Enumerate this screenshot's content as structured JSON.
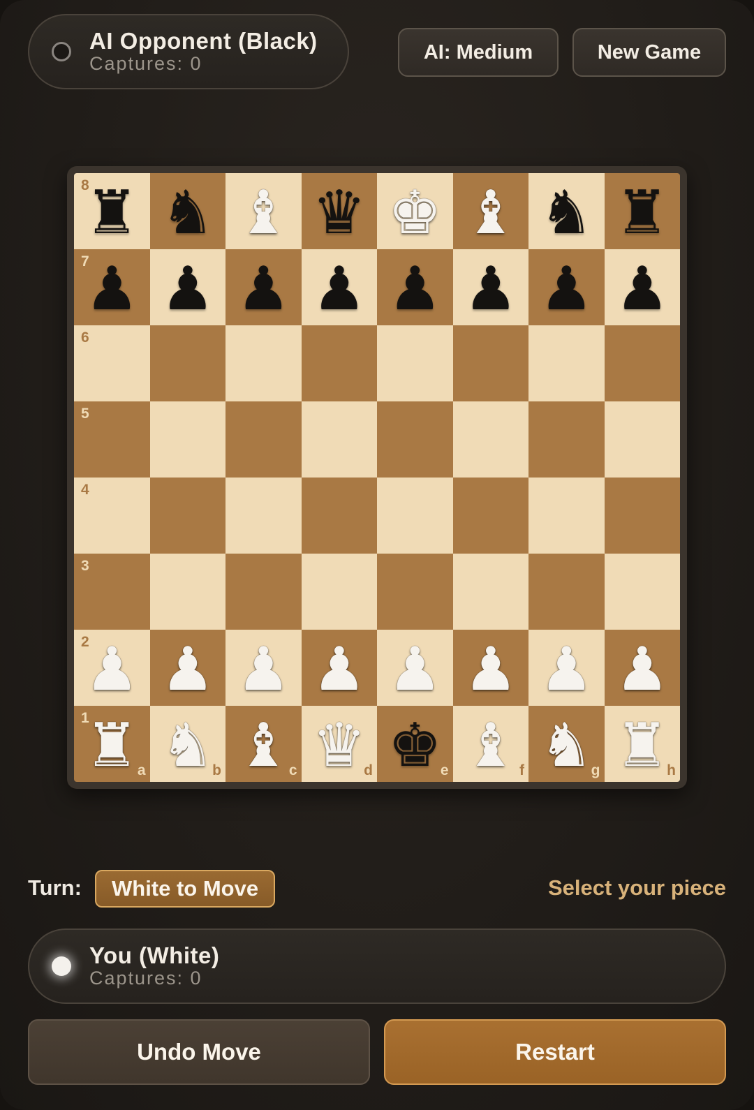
{
  "opponent": {
    "name": "AI Opponent (Black)",
    "captures": "Captures: 0"
  },
  "toolbar": {
    "ai_level_label": "AI: Medium",
    "new_game_label": "New Game"
  },
  "board": {
    "rank_labels": [
      "8",
      "7",
      "6",
      "5",
      "4",
      "3",
      "2",
      "1"
    ],
    "file_labels": [
      "a",
      "b",
      "c",
      "d",
      "e",
      "f",
      "g",
      "h"
    ],
    "pieces": [
      [
        "black-rook",
        "black-knight",
        "white-bishop",
        "black-queen",
        "white-king",
        "white-bishop",
        "black-knight",
        "black-rook"
      ],
      [
        "black-pawn",
        "black-pawn",
        "black-pawn",
        "black-pawn",
        "black-pawn",
        "black-pawn",
        "black-pawn",
        "black-pawn"
      ],
      [
        "",
        "",
        "",
        "",
        "",
        "",
        "",
        ""
      ],
      [
        "",
        "",
        "",
        "",
        "",
        "",
        "",
        ""
      ],
      [
        "",
        "",
        "",
        "",
        "",
        "",
        "",
        ""
      ],
      [
        "",
        "",
        "",
        "",
        "",
        "",
        "",
        ""
      ],
      [
        "white-pawn",
        "white-pawn",
        "white-pawn",
        "white-pawn",
        "white-pawn",
        "white-pawn",
        "white-pawn",
        "white-pawn"
      ],
      [
        "white-rook",
        "white-knight",
        "white-bishop",
        "white-queen",
        "black-king",
        "white-bishop",
        "white-knight",
        "white-rook"
      ]
    ],
    "light_color": "#f0dbb6",
    "dark_color": "#a97944"
  },
  "status": {
    "turn_label": "Turn:",
    "turn_value": "White to Move",
    "hint": "Select your piece"
  },
  "player": {
    "name": "You (White)",
    "captures": "Captures: 0"
  },
  "actions": {
    "undo_label": "Undo Move",
    "restart_label": "Restart"
  },
  "colors": {
    "accent": "#a97031",
    "accent_text": "#d8b27a",
    "background": "#211d19"
  }
}
